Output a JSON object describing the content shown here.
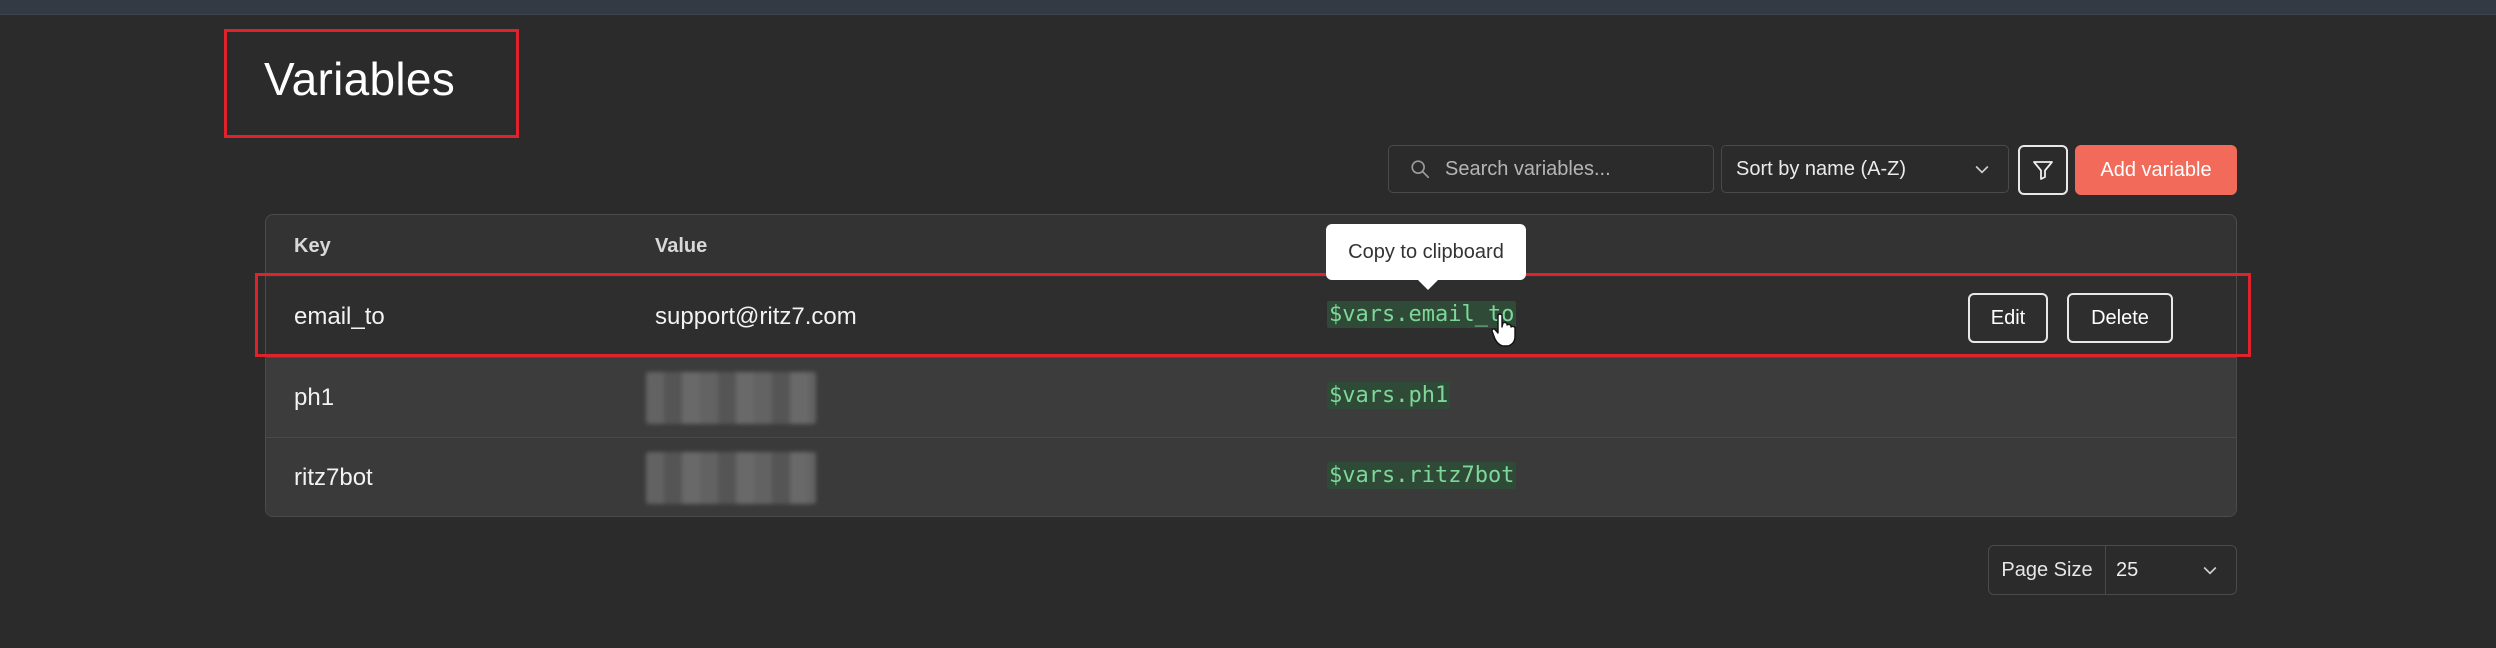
{
  "page": {
    "title": "Variables"
  },
  "toolbar": {
    "search_placeholder": "Search variables...",
    "sort_label": "Sort by name (A-Z)",
    "add_label": "Add variable"
  },
  "table": {
    "headers": {
      "key": "Key",
      "value": "Value"
    },
    "rows": [
      {
        "key": "email_to",
        "value": "support@ritz7.com",
        "ref": "$vars.email_to",
        "edit": "Edit",
        "delete": "Delete"
      },
      {
        "key": "ph1",
        "value": "",
        "ref": "$vars.ph1"
      },
      {
        "key": "ritz7bot",
        "value": "",
        "ref": "$vars.ritz7bot"
      }
    ]
  },
  "tooltip": {
    "text": "Copy to clipboard"
  },
  "pagination": {
    "page_size_label": "Page Size",
    "page_size_value": "25"
  },
  "colors": {
    "accent": "#f26b5a",
    "highlight": "#e0222d",
    "code": "#7ed79a"
  }
}
